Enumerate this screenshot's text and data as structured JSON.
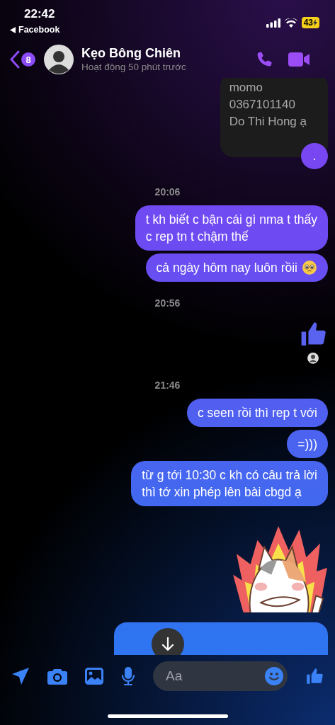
{
  "status_bar": {
    "time": "22:42",
    "back_app": "Facebook",
    "battery": "43"
  },
  "header": {
    "unread_count": "8",
    "name": "Kẹo Bông Chiên",
    "status": "Hoạt động 50 phút trước"
  },
  "messages": [
    {
      "kind": "received",
      "text": "momo\n0367101140\nDo Thi Hong ạ"
    },
    {
      "kind": "sent_dot",
      "text": "."
    },
    {
      "kind": "time",
      "text": "20:06"
    },
    {
      "kind": "sent",
      "text": "t kh biết c bận cái gì nma t thấy\nc rep tn t chậm thế"
    },
    {
      "kind": "sent_emoji",
      "text": "cả ngày hôm nay luôn rồii"
    },
    {
      "kind": "time",
      "text": "20:56"
    },
    {
      "kind": "like"
    },
    {
      "kind": "seen"
    },
    {
      "kind": "time",
      "text": "21:46"
    },
    {
      "kind": "sent",
      "text": "c seen rồi thì rep t với"
    },
    {
      "kind": "sent",
      "text": "=)))"
    },
    {
      "kind": "sent",
      "text": "từ g tới 10:30 c kh có câu trả lời\nthì tớ xin phép lên bài cbgd ạ"
    },
    {
      "kind": "sticker"
    },
    {
      "kind": "cut_off"
    }
  ],
  "composer": {
    "placeholder": "Aa"
  }
}
